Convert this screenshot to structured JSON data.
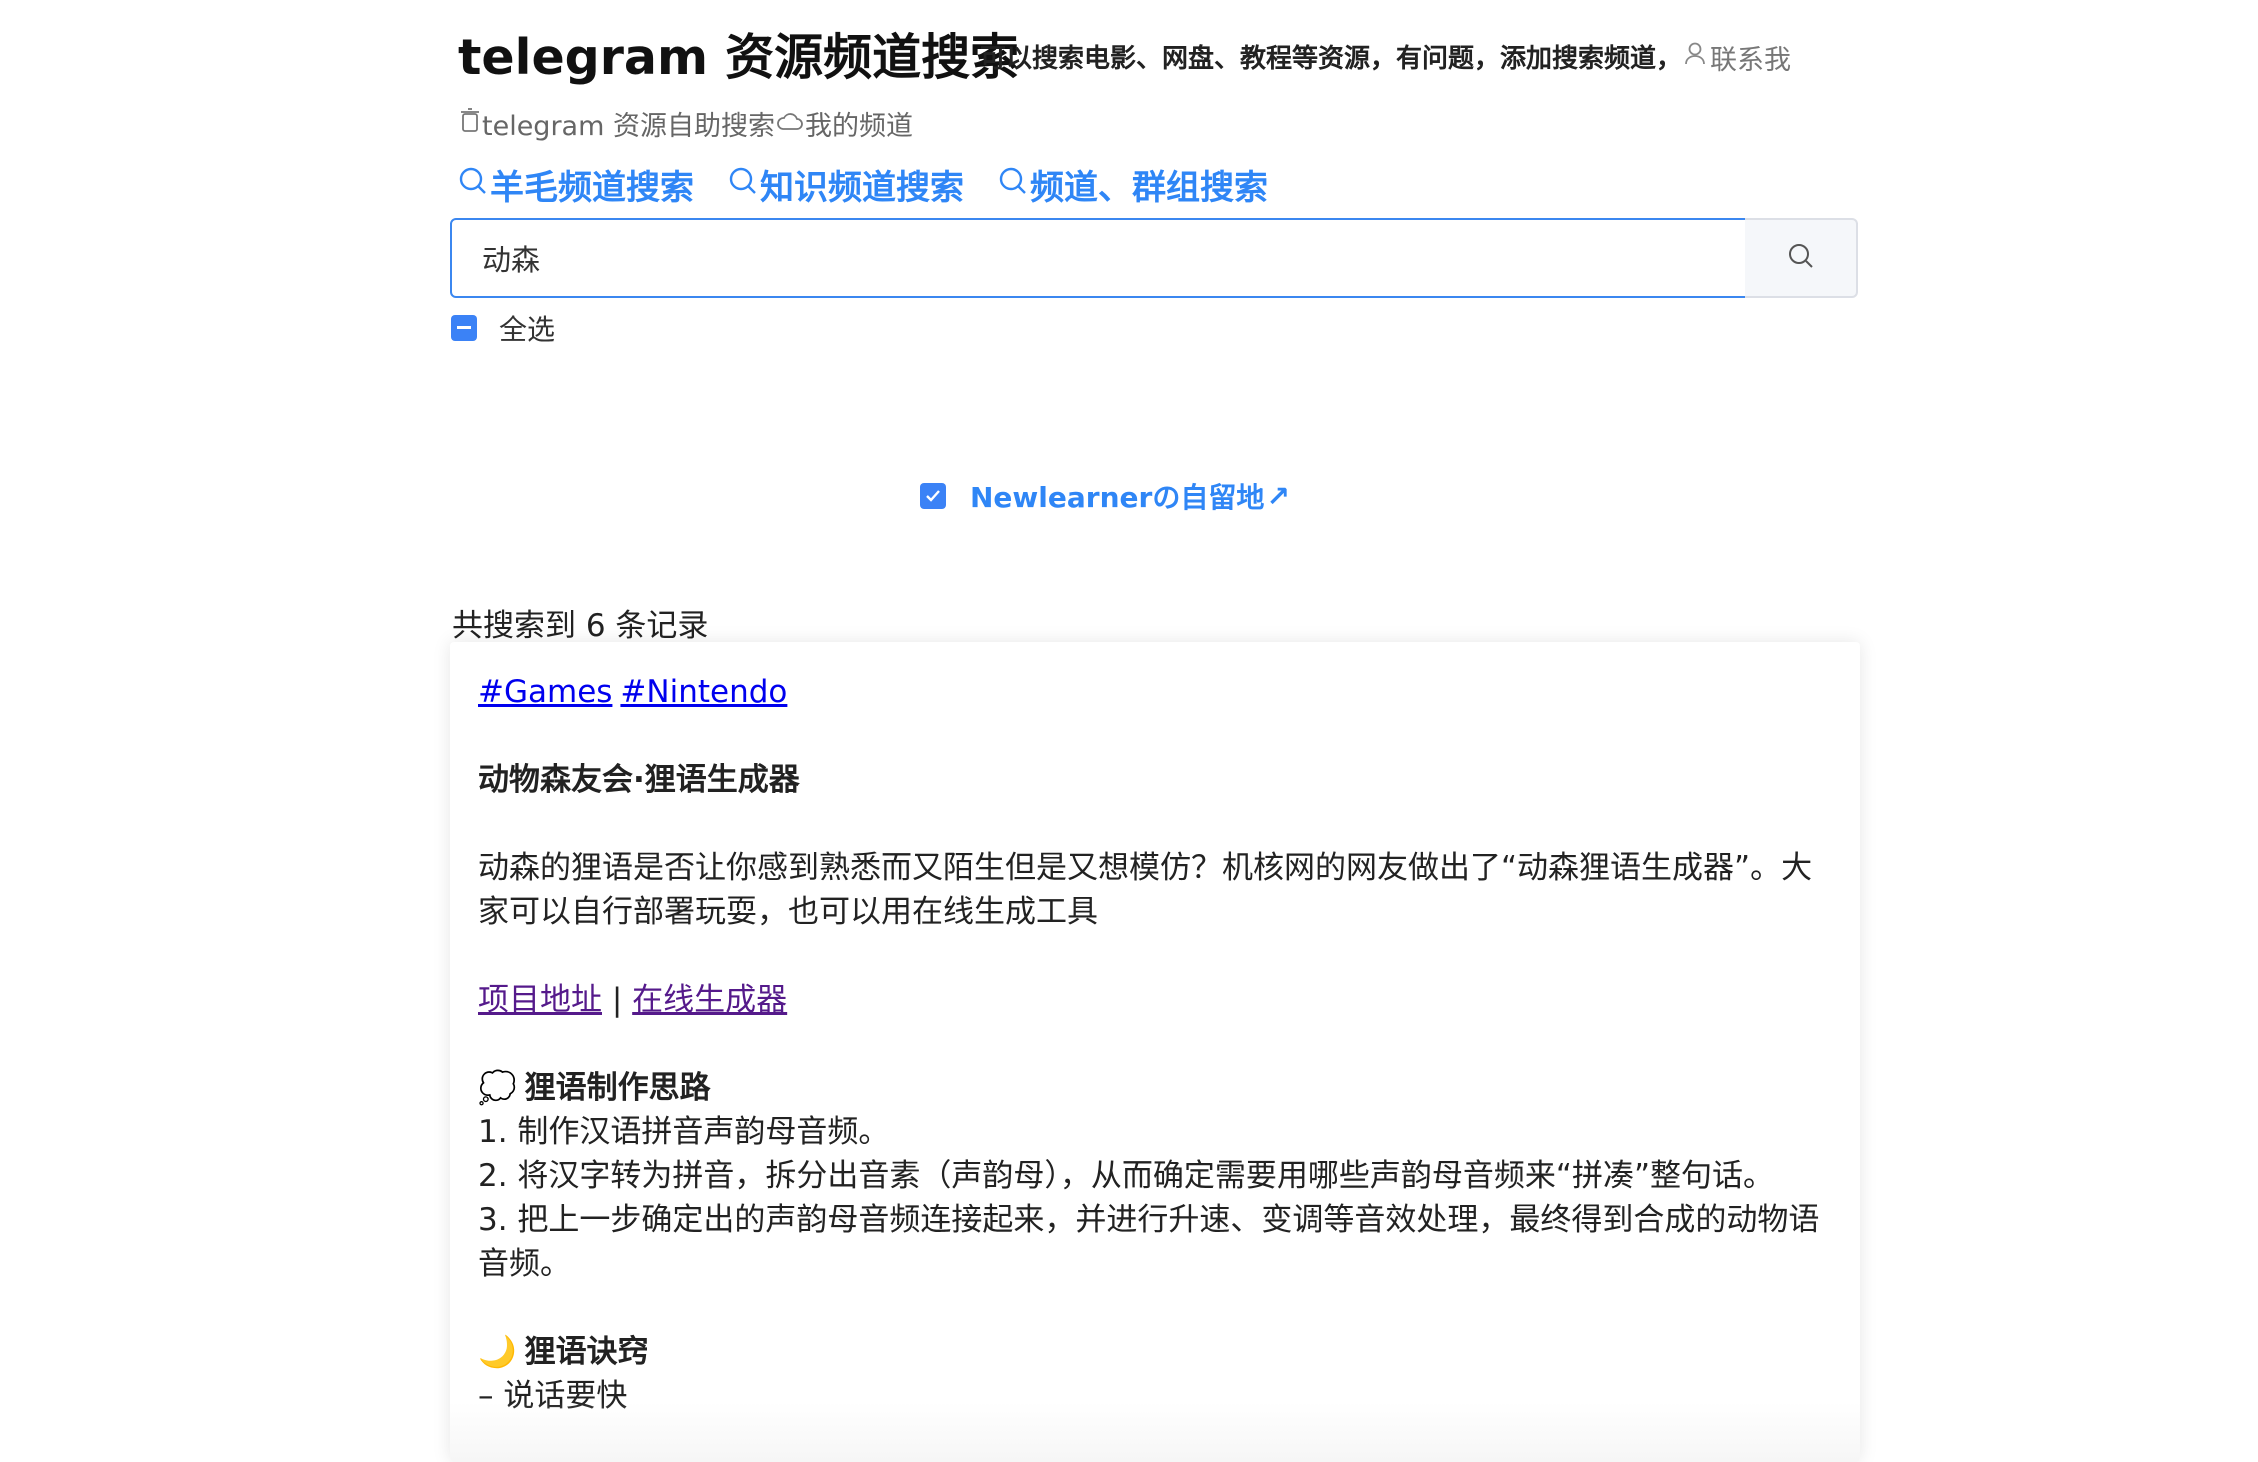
{
  "header": {
    "title": "telegram 资源频道搜索",
    "subtitle": "可以搜索电影、网盘、教程等资源，有问题，添加搜索频道，",
    "contact_label": "联系我",
    "subnav_self_search": "telegram 资源自助搜索",
    "subnav_my_channel": "我的频道"
  },
  "search_nav": [
    {
      "label": "羊毛频道搜索"
    },
    {
      "label": "知识频道搜索"
    },
    {
      "label": "频道、群组搜索"
    }
  ],
  "search": {
    "value": "动森"
  },
  "select_all_label": "全选",
  "channel_option": {
    "label": "Newlearnerの自留地",
    "checked": true,
    "arrow": "↗"
  },
  "result_count": "共搜索到 6 条记录",
  "result": {
    "tags": [
      "#Games",
      "#Nintendo"
    ],
    "title": "动物森友会·狸语生成器",
    "description": "动森的狸语是否让你感到熟悉而又陌生但是又想模仿？机核网的网友做出了“动森狸语生成器”。大家可以自行部署玩耍，也可以用在线生成工具",
    "link_project": "项目地址",
    "link_separator": "|",
    "link_online": "在线生成器",
    "section1_emoji": "💭",
    "section1_title": "狸语制作思路",
    "steps": [
      "1. 制作汉语拼音声韵母音频。",
      "2. 将汉字转为拼音，拆分出音素（声韵母），从而确定需要用哪些声韵母音频来“拼凑”整句话。",
      "3. 把上一步确定出的声韵母音频连接起来，并进行升速、变调等音效处理，最终得到合成的动物语音频。"
    ],
    "section2_emoji": "🌙",
    "section2_title": "狸语诀窍",
    "tip1": "– 说话要快"
  },
  "colors": {
    "accent": "#2f86f6",
    "link": "#0000ee",
    "visited_link": "#551a8b",
    "checkbox": "#3b82f6"
  }
}
